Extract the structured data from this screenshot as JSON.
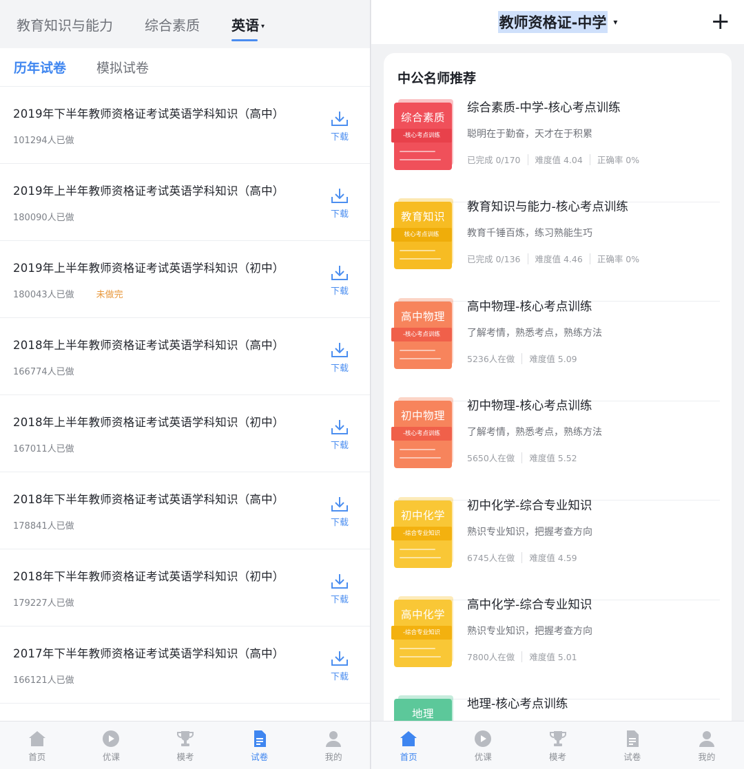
{
  "left": {
    "top_tabs": [
      {
        "label": "教育知识与能力"
      },
      {
        "label": "综合素质"
      },
      {
        "label": "英语",
        "caret": "▾"
      }
    ],
    "sub_tabs": [
      {
        "label": "历年试卷"
      },
      {
        "label": "模拟试卷"
      }
    ],
    "download_label": "下载",
    "papers": [
      {
        "title": "2019年下半年教师资格证考试英语学科知识（高中）",
        "count": "101294人已做",
        "status": ""
      },
      {
        "title": "2019年上半年教师资格证考试英语学科知识（高中）",
        "count": "180090人已做",
        "status": ""
      },
      {
        "title": "2019年上半年教师资格证考试英语学科知识（初中）",
        "count": "180043人已做",
        "status": "未做完"
      },
      {
        "title": "2018年上半年教师资格证考试英语学科知识（高中）",
        "count": "166774人已做",
        "status": ""
      },
      {
        "title": "2018年上半年教师资格证考试英语学科知识（初中）",
        "count": "167011人已做",
        "status": ""
      },
      {
        "title": "2018年下半年教师资格证考试英语学科知识（高中）",
        "count": "178841人已做",
        "status": ""
      },
      {
        "title": "2018年下半年教师资格证考试英语学科知识（初中）",
        "count": "179227人已做",
        "status": ""
      },
      {
        "title": "2017年下半年教师资格证考试英语学科知识（高中）",
        "count": "166121人已做",
        "status": ""
      }
    ],
    "nav": [
      {
        "label": "首页",
        "icon": "home-icon"
      },
      {
        "label": "优课",
        "icon": "play-icon"
      },
      {
        "label": "模考",
        "icon": "trophy-icon"
      },
      {
        "label": "试卷",
        "icon": "document-icon"
      },
      {
        "label": "我的",
        "icon": "user-icon"
      }
    ]
  },
  "right": {
    "header_title": "教师资格证-中学",
    "header_caret": "▾",
    "plus": "+",
    "section_title": "中公名师推荐",
    "courses": [
      {
        "cover_title": "综合素质",
        "cover_sub": "-核心考点训练",
        "name": "综合素质-中学-核心考点训练",
        "desc": "聪明在于勤奋，天才在于积累",
        "stats": [
          "已完成 0/170",
          "难度值 4.04",
          "正确率 0%"
        ],
        "color": "#f0505a",
        "color2": "#e8414b"
      },
      {
        "cover_title": "教育知识",
        "cover_sub": "核心考点训练",
        "name": "教育知识与能力-核心考点训练",
        "desc": "教育千锤百炼，练习熟能生巧",
        "stats": [
          "已完成 0/136",
          "难度值 4.46",
          "正确率 0%"
        ],
        "color": "#f7bc23",
        "color2": "#efad0a"
      },
      {
        "cover_title": "高中物理",
        "cover_sub": "-核心考点训练",
        "name": "高中物理-核心考点训练",
        "desc": "了解考情，熟悉考点，熟练方法",
        "stats": [
          "5236人在做",
          "难度值 5.09"
        ],
        "color": "#f7845c",
        "color2": "#f0604a"
      },
      {
        "cover_title": "初中物理",
        "cover_sub": "-核心考点训练",
        "name": "初中物理-核心考点训练",
        "desc": "了解考情，熟悉考点，熟练方法",
        "stats": [
          "5650人在做",
          "难度值 5.52"
        ],
        "color": "#f7845c",
        "color2": "#f0604a"
      },
      {
        "cover_title": "初中化学",
        "cover_sub": "-综合专业知识",
        "name": "初中化学-综合专业知识",
        "desc": "熟识专业知识，把握考查方向",
        "stats": [
          "6745人在做",
          "难度值 4.59"
        ],
        "color": "#f9c736",
        "color2": "#f3b10f"
      },
      {
        "cover_title": "高中化学",
        "cover_sub": "-综合专业知识",
        "name": "高中化学-综合专业知识",
        "desc": "熟识专业知识，把握考查方向",
        "stats": [
          "7800人在做",
          "难度值 5.01"
        ],
        "color": "#f9c736",
        "color2": "#f3b10f"
      },
      {
        "cover_title": "地理",
        "cover_sub": "",
        "name": "地理-核心考点训练",
        "desc": "",
        "stats": [],
        "color": "#5cc89a",
        "color2": "#3fb884"
      }
    ],
    "nav": [
      {
        "label": "首页",
        "icon": "home-icon"
      },
      {
        "label": "优课",
        "icon": "play-icon"
      },
      {
        "label": "模考",
        "icon": "trophy-icon"
      },
      {
        "label": "试卷",
        "icon": "document-icon"
      },
      {
        "label": "我的",
        "icon": "user-icon"
      }
    ]
  }
}
